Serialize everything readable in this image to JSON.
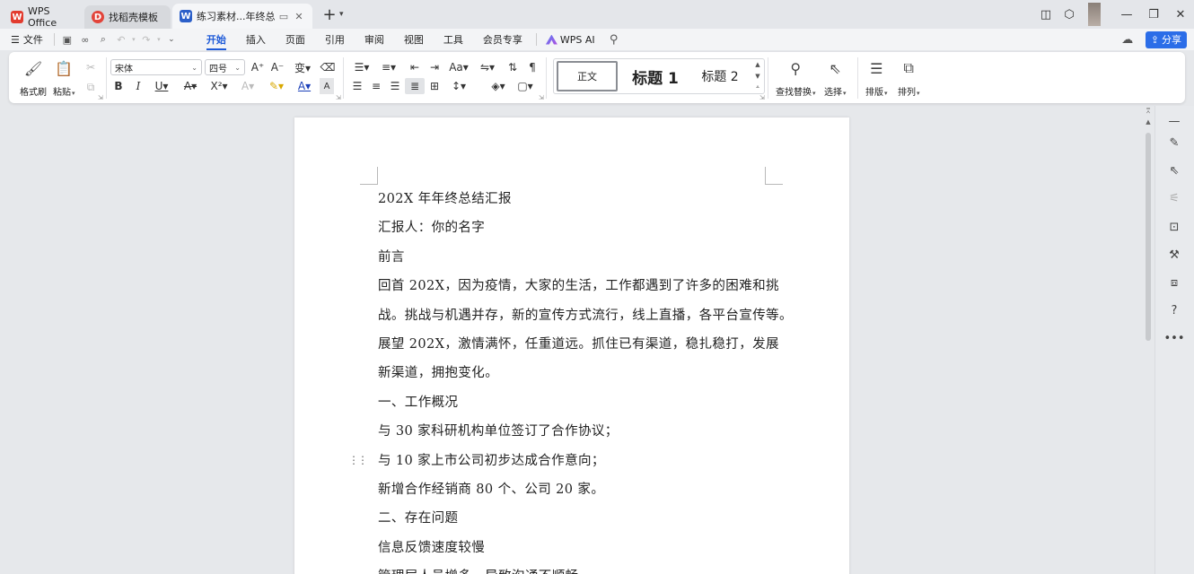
{
  "titlebar": {
    "tabs": [
      {
        "label": "WPS Office",
        "icon": "wps-logo-icon"
      },
      {
        "label": "找稻壳模板",
        "icon": "docer-icon"
      },
      {
        "label": "练习素材...年终总结",
        "icon": "word-doc-icon"
      }
    ],
    "colors": {
      "accent": "#1f5bd8",
      "wps_red": "#e23b2e",
      "word_blue": "#2b5fc9"
    }
  },
  "menubar": {
    "file": "文件",
    "tabs": [
      "开始",
      "插入",
      "页面",
      "引用",
      "审阅",
      "视图",
      "工具",
      "会员专享"
    ],
    "active": "开始",
    "ai": "WPS AI",
    "share": "分享"
  },
  "ribbon": {
    "format_painter": "格式刷",
    "paste": "粘贴",
    "font_name": "宋体",
    "font_size": "四号",
    "styles": {
      "normal": "正文",
      "h1": "标题 1",
      "h2": "标题 2"
    },
    "find_replace": "查找替换",
    "select": "选择",
    "layout": "排版",
    "arrange": "排列"
  },
  "document": {
    "lines": [
      "202X 年年终总结汇报",
      "汇报人：你的名字",
      "前言",
      "回首 202X，因为疫情，大家的生活，工作都遇到了许多的困难和挑",
      "战。挑战与机遇并存，新的宣传方式流行，线上直播，各平台宣传等。",
      "展望 202X，激情满怀，任重道远。抓住已有渠道，稳扎稳打，发展",
      "新渠道，拥抱变化。",
      "一、工作概况",
      "与 30 家科研机构单位签订了合作协议；",
      "与 10 家上市公司初步达成合作意向；",
      "新增合作经销商 80 个、公司 20 家。",
      "二、存在问题",
      "信息反馈速度较慢",
      "管理层人员增多，导致沟通不顺畅"
    ]
  }
}
